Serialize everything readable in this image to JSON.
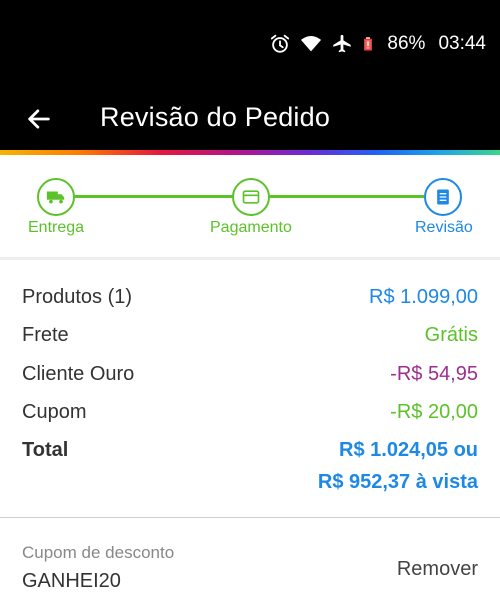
{
  "status_bar": {
    "battery": "86%",
    "time": "03:44",
    "icons": [
      "alarm-icon",
      "wifi-icon",
      "airplane-icon",
      "battery-icon"
    ]
  },
  "app_bar": {
    "title": "Revisão do Pedido",
    "back_icon": "arrow-left-icon"
  },
  "stepper": {
    "steps": [
      {
        "label": "Entrega",
        "icon": "truck-icon",
        "state": "done"
      },
      {
        "label": "Pagamento",
        "icon": "credit-card-icon",
        "state": "done"
      },
      {
        "label": "Revisão",
        "icon": "document-icon",
        "state": "current"
      }
    ]
  },
  "summary": {
    "products_label": "Produtos (1)",
    "products_value": "R$ 1.099,00",
    "shipping_label": "Frete",
    "shipping_value": "Grátis",
    "gold_label": "Cliente Ouro",
    "gold_value": "-R$ 54,95",
    "coupon_label": "Cupom",
    "coupon_value": "-R$ 20,00",
    "total_label": "Total",
    "total_value_line1": "R$ 1.024,05 ou",
    "total_value_line2": "R$ 952,37 à vista"
  },
  "coupon": {
    "label": "Cupom de desconto",
    "code": "GANHEI20",
    "remove_label": "Remover"
  },
  "colors": {
    "green": "#5cc22a",
    "blue": "#1e88e5",
    "purple": "#9c2f8f",
    "app_bar": "#000000"
  }
}
